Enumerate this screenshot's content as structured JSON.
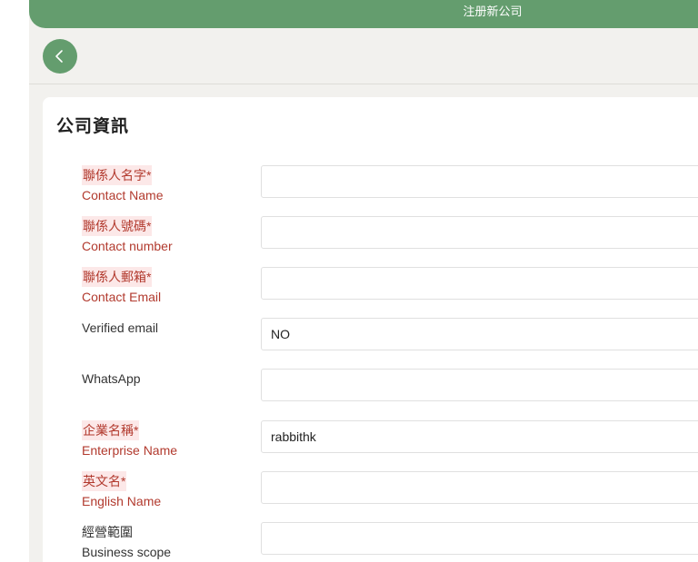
{
  "header": {
    "title": "注册新公司"
  },
  "back_button": {
    "icon": "chevron-left-icon"
  },
  "card": {
    "title": "公司資訊"
  },
  "fields": [
    {
      "label_zh": "聯係人名字*",
      "label_en": "Contact Name",
      "value": "",
      "required": true
    },
    {
      "label_zh": "聯係人號碼*",
      "label_en": "Contact number",
      "value": "",
      "required": true
    },
    {
      "label_zh": "聯係人郵箱*",
      "label_en": "Contact Email",
      "value": "",
      "required": true
    },
    {
      "label_zh": "",
      "label_en": "Verified email",
      "value": "NO",
      "required": false
    },
    {
      "label_zh": "",
      "label_en": "WhatsApp",
      "value": "",
      "required": false
    },
    {
      "label_zh": "企業名稱*",
      "label_en": "Enterprise Name",
      "value": "rabbithk",
      "required": true
    },
    {
      "label_zh": "英文名*",
      "label_en": "English Name",
      "value": "",
      "required": true
    },
    {
      "label_zh": "經營範圍",
      "label_en": "Business scope",
      "value": "",
      "required": false
    }
  ],
  "colors": {
    "brand": "#649d6e",
    "required_label": "#b23a2e",
    "background": "#f2f1ee"
  }
}
